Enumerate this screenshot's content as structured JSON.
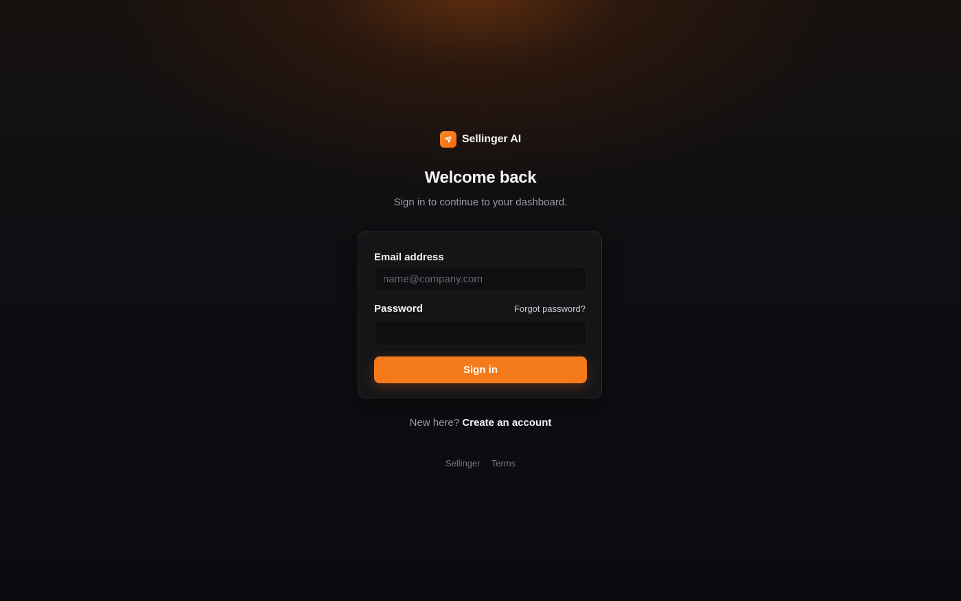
{
  "brand": {
    "name": "Sellinger AI",
    "logo_icon": "rocket-icon",
    "logo_color": "#f57a1b"
  },
  "heading": {
    "title": "Welcome back",
    "subtitle": "Sign in to continue to your dashboard."
  },
  "form": {
    "email_label": "Email address",
    "email_placeholder": "name@company.com",
    "email_value": "",
    "password_label": "Password",
    "password_value": "",
    "forgot_label": "Forgot password?",
    "submit_label": "Sign in"
  },
  "signup": {
    "prompt": "New here?",
    "link_label": "Create an account"
  },
  "footer": {
    "links": [
      "Sellinger",
      "Terms"
    ]
  },
  "colors": {
    "accent": "#f57a1b",
    "background": "#0c0c10",
    "card": "#151518"
  }
}
